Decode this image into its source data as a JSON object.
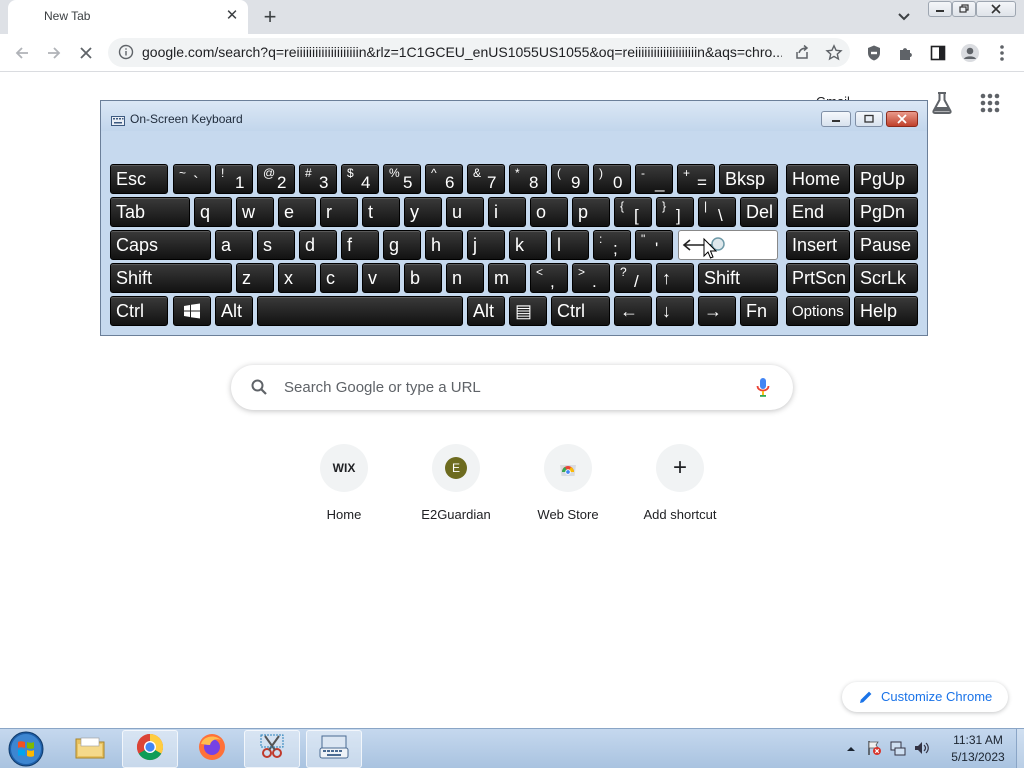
{
  "browser": {
    "tab_title": "New Tab",
    "tab_close": "✕",
    "new_tab": "+",
    "url": "google.com/search?q=reiiiiiiiiiiiiiiiiiiiin&rlz=1C1GCEU_enUS1055US1055&oq=reiiiiiiiiiiiiiiiiiiiin&aqs=chro..."
  },
  "ntp": {
    "gmail_link": "Gmail",
    "search_placeholder": "Search Google or type a URL",
    "shortcuts": [
      {
        "label": "Home",
        "icon": "wix-icon",
        "icon_text": "WIX"
      },
      {
        "label": "E2Guardian",
        "icon": "e2guardian-icon",
        "icon_text": "E"
      },
      {
        "label": "Web Store",
        "icon": "web-store-icon",
        "icon_text": ""
      },
      {
        "label": "Add shortcut",
        "icon": "plus-icon",
        "icon_text": "+"
      }
    ],
    "customize_label": "Customize Chrome"
  },
  "osk": {
    "title": "On-Screen Keyboard",
    "rows": [
      [
        {
          "main": "Esc"
        },
        {
          "shift": "~",
          "main": "`"
        },
        {
          "shift": "!",
          "main": "1"
        },
        {
          "shift": "@",
          "main": "2"
        },
        {
          "shift": "#",
          "main": "3"
        },
        {
          "shift": "$",
          "main": "4"
        },
        {
          "shift": "%",
          "main": "5"
        },
        {
          "shift": "^",
          "main": "6"
        },
        {
          "shift": "&",
          "main": "7"
        },
        {
          "shift": "*",
          "main": "8"
        },
        {
          "shift": "(",
          "main": "9"
        },
        {
          "shift": ")",
          "main": "0"
        },
        {
          "shift": "-",
          "main": "_"
        },
        {
          "shift": "+",
          "main": "="
        },
        {
          "main": "Bksp"
        },
        {
          "main": "Home"
        },
        {
          "main": "PgUp"
        }
      ],
      [
        {
          "main": "Tab"
        },
        {
          "main": "q"
        },
        {
          "main": "w"
        },
        {
          "main": "e"
        },
        {
          "main": "r"
        },
        {
          "main": "t"
        },
        {
          "main": "y"
        },
        {
          "main": "u"
        },
        {
          "main": "i"
        },
        {
          "main": "o"
        },
        {
          "main": "p"
        },
        {
          "shift": "{",
          "main": "["
        },
        {
          "shift": "}",
          "main": "]"
        },
        {
          "shift": "|",
          "main": "\\"
        },
        {
          "main": "Del"
        },
        {
          "main": "End"
        },
        {
          "main": "PgDn"
        }
      ],
      [
        {
          "main": "Caps"
        },
        {
          "main": "a"
        },
        {
          "main": "s"
        },
        {
          "main": "d"
        },
        {
          "main": "f"
        },
        {
          "main": "g"
        },
        {
          "main": "h"
        },
        {
          "main": "j"
        },
        {
          "main": "k"
        },
        {
          "main": "l"
        },
        {
          "shift": ":",
          "main": ";"
        },
        {
          "shift": "\"",
          "main": "'"
        },
        {
          "main": "",
          "enter": true
        },
        {
          "main": "Insert"
        },
        {
          "main": "Pause"
        }
      ],
      [
        {
          "main": "Shift"
        },
        {
          "main": "z"
        },
        {
          "main": "x"
        },
        {
          "main": "c"
        },
        {
          "main": "v"
        },
        {
          "main": "b"
        },
        {
          "main": "n"
        },
        {
          "main": "m"
        },
        {
          "shift": "<",
          "main": ","
        },
        {
          "shift": ">",
          "main": "."
        },
        {
          "shift": "?",
          "main": "/"
        },
        {
          "main": "↑"
        },
        {
          "main": "Shift"
        },
        {
          "main": "PrtScn"
        },
        {
          "main": "ScrLk"
        }
      ],
      [
        {
          "main": "Ctrl"
        },
        {
          "main": "",
          "win": true
        },
        {
          "main": "Alt"
        },
        {
          "main": ""
        },
        {
          "main": "Alt"
        },
        {
          "main": "▤"
        },
        {
          "main": "Ctrl"
        },
        {
          "main": "←"
        },
        {
          "main": "↓"
        },
        {
          "main": "→"
        },
        {
          "main": "Fn"
        },
        {
          "main": "Options",
          "small": true
        },
        {
          "main": "Help"
        }
      ]
    ]
  },
  "taskbar": {
    "time": "11:31 AM",
    "date": "5/13/2023"
  },
  "colors": {
    "tabstrip": "#dee1e6",
    "omnibox": "#f1f3f4",
    "osk_body": "#c6d9ee",
    "key": "#1e1e1e",
    "accent_link": "#1a73e8"
  }
}
